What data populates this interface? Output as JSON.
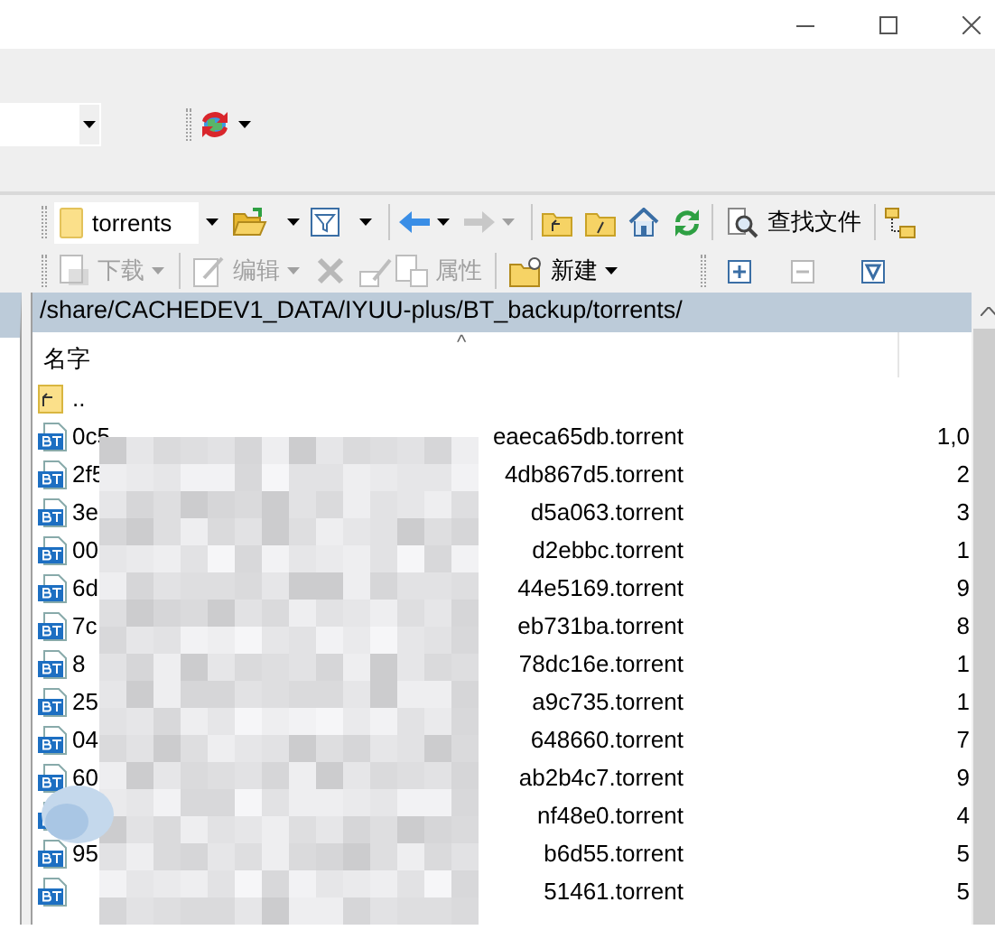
{
  "navigation_toolbar": {
    "path_combo": {
      "value": "torrents"
    },
    "forward_button": {
      "disabled": true
    },
    "find_button": {
      "label": "查找文件"
    }
  },
  "file_toolbar": {
    "download": {
      "label": "下载",
      "disabled": true
    },
    "edit": {
      "label": "编辑",
      "disabled": true
    },
    "delete": {
      "disabled": true
    },
    "rename": {
      "disabled": true
    },
    "properties": {
      "label": "属性",
      "disabled": true
    },
    "new": {
      "label": "新建",
      "disabled": false
    },
    "expand": {
      "disabled": false
    },
    "collapse": {
      "disabled": true
    },
    "filter": {
      "disabled": false
    }
  },
  "path_bar": {
    "path": "/share/CACHEDEV1_DATA/IYUU-plus/BT_backup/torrents/"
  },
  "file_list": {
    "columns": [
      "名字"
    ],
    "sort_indicator": "^",
    "redacted": true,
    "rows": [
      {
        "kind": "parent",
        "name_start": ".."
      },
      {
        "kind": "torrent",
        "name_start": "0c5",
        "name_end": "eaeca65db.torrent",
        "size": "1,0"
      },
      {
        "kind": "torrent",
        "name_start": "2f5",
        "name_end": "4db867d5.torrent",
        "size": "2"
      },
      {
        "kind": "torrent",
        "name_start": "3e",
        "name_end": "d5a063.torrent",
        "size": "3"
      },
      {
        "kind": "torrent",
        "name_start": "00",
        "name_end": "d2ebbc.torrent",
        "size": "1"
      },
      {
        "kind": "torrent",
        "name_start": "6d",
        "name_end": "44e5169.torrent",
        "size": "9"
      },
      {
        "kind": "torrent",
        "name_start": "7c",
        "name_end": "eb731ba.torrent",
        "size": "8"
      },
      {
        "kind": "torrent",
        "name_start": "8",
        "name_end": "78dc16e.torrent",
        "size": "1"
      },
      {
        "kind": "torrent",
        "name_start": "25",
        "name_end": "a9c735.torrent",
        "size": "1"
      },
      {
        "kind": "torrent",
        "name_start": "04",
        "name_end": "648660.torrent",
        "size": "7"
      },
      {
        "kind": "torrent",
        "name_start": "60",
        "name_end": "ab2b4c7.torrent",
        "size": "9"
      },
      {
        "kind": "torrent",
        "name_end": "nf48e0.torrent",
        "size": "4"
      },
      {
        "kind": "torrent",
        "name_start": "95",
        "name_end": "b6d55.torrent",
        "size": "5"
      },
      {
        "kind": "torrent",
        "name_end": "51461.torrent",
        "size": "5"
      }
    ]
  }
}
